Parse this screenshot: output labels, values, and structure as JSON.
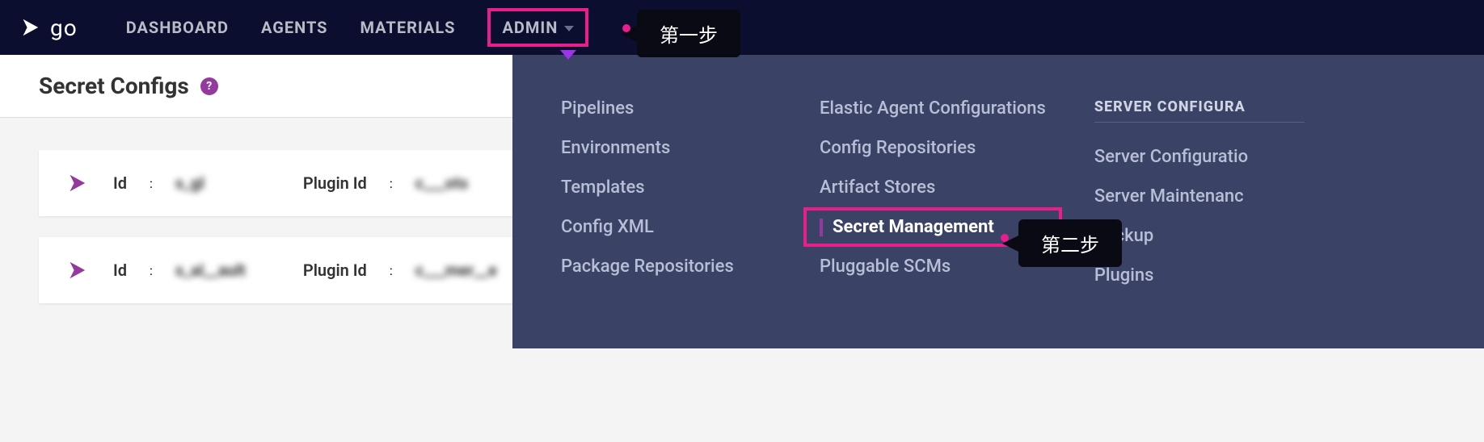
{
  "nav": {
    "logo_text": "go",
    "items": [
      "DASHBOARD",
      "AGENTS",
      "MATERIALS",
      "ADMIN"
    ]
  },
  "callouts": {
    "step1": "第一步",
    "step2": "第二步"
  },
  "page": {
    "title": "Secret Configs"
  },
  "configs": [
    {
      "id_label": "Id",
      "id_value": "s_gl",
      "plugin_label": "Plugin Id",
      "plugin_value": "c___ots"
    },
    {
      "id_label": "Id",
      "id_value": "s_al__ault",
      "plugin_label": "Plugin Id",
      "plugin_value": "c___mer__e"
    }
  ],
  "dropdown": {
    "col1": [
      "Pipelines",
      "Environments",
      "Templates",
      "Config XML",
      "Package Repositories"
    ],
    "col2": [
      "Elastic Agent Configurations",
      "Config Repositories",
      "Artifact Stores",
      "Secret Management",
      "Pluggable SCMs"
    ],
    "col3_heading": "SERVER CONFIGURA",
    "col3": [
      "Server Configuratio",
      "Server Maintenanc",
      "Backup",
      "Plugins"
    ]
  }
}
